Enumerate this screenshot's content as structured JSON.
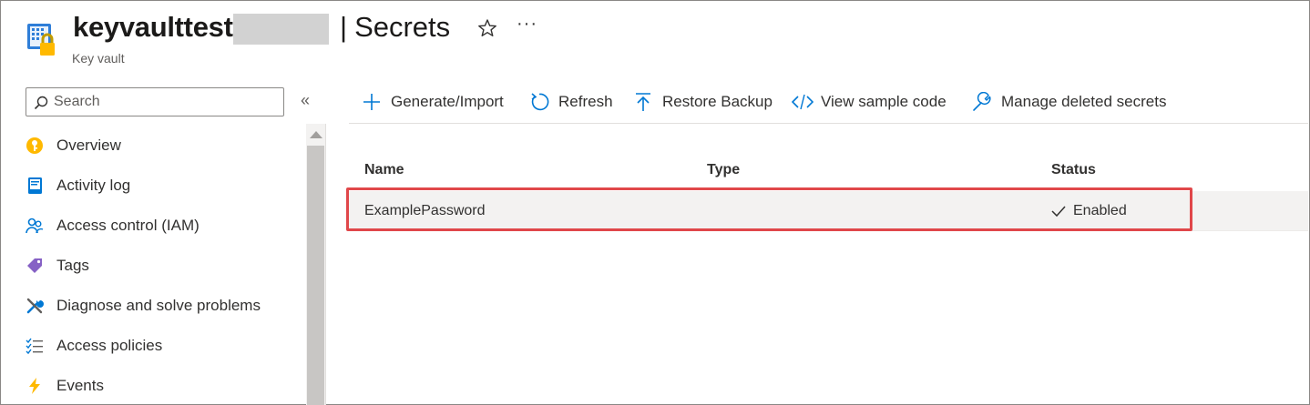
{
  "header": {
    "vault_name": "keyvaulttest",
    "separator": "|",
    "page_title": "Secrets",
    "resource_type": "Key vault",
    "favorite_icon": "star-icon",
    "more_label": "···"
  },
  "sidebar": {
    "search_placeholder": "Search",
    "collapse_label": "«",
    "items": [
      {
        "label": "Overview",
        "icon": "key-icon"
      },
      {
        "label": "Activity log",
        "icon": "activity-log-icon"
      },
      {
        "label": "Access control (IAM)",
        "icon": "people-icon"
      },
      {
        "label": "Tags",
        "icon": "tag-icon"
      },
      {
        "label": "Diagnose and solve problems",
        "icon": "wrench-icon"
      },
      {
        "label": "Access policies",
        "icon": "checklist-icon"
      },
      {
        "label": "Events",
        "icon": "lightning-icon"
      }
    ]
  },
  "toolbar": {
    "generate_import": "Generate/Import",
    "refresh": "Refresh",
    "restore_backup": "Restore Backup",
    "view_sample_code": "View sample code",
    "manage_deleted": "Manage deleted secrets"
  },
  "table": {
    "columns": [
      "Name",
      "Type",
      "Status"
    ],
    "rows": [
      {
        "name": "ExamplePassword",
        "type": "",
        "status": "Enabled"
      }
    ]
  },
  "colors": {
    "highlight": "#e0474a",
    "accent": "#0078d4",
    "row_bg": "#f3f2f1"
  }
}
